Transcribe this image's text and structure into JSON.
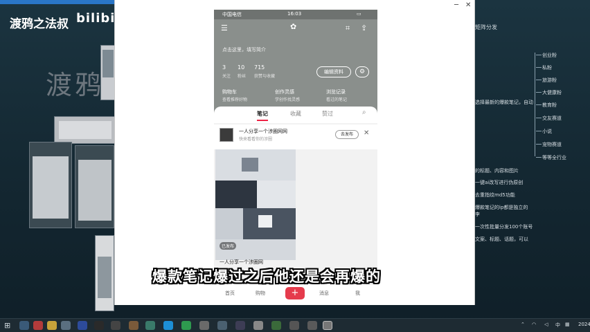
{
  "desktop": {
    "channel_title": "渡鸦之法叔",
    "bili_logo": "bilibili",
    "watermark": "渡鸦之法叔"
  },
  "right_panel": {
    "header": "矩阵分发",
    "mindmap_items": [
      "创业粉",
      "私粉",
      "旅游粉",
      "大健康粉",
      "教育粉",
      "交友赛道",
      "小说",
      "宠物赛道",
      "等等全行业"
    ],
    "notes": [
      "选择最新的爆款笔记，自动",
      "的标题、内容和图片",
      "一键ai改写进行伪原创",
      "去重指纹md5功能",
      "爆款笔记的ip都是独立的",
      "李",
      "一次性批量分发100个账号",
      "文案、标题、话题，可以"
    ]
  },
  "phone": {
    "status": {
      "carrier": "中国电信",
      "time": "16:03"
    },
    "profile": {
      "bio": "点击这里，填写简介",
      "stats": [
        {
          "value": "3",
          "label": "关注"
        },
        {
          "value": "10",
          "label": "粉丝"
        },
        {
          "value": "715",
          "label": "获赞与收藏"
        }
      ],
      "edit_button": "编辑资料",
      "features": [
        {
          "title": "购物车",
          "sub": "查看推荐好物"
        },
        {
          "title": "创作灵感",
          "sub": "学创作找灵感"
        },
        {
          "title": "浏览记录",
          "sub": "看过的笔记"
        }
      ]
    },
    "tabs": [
      "笔记",
      "收藏",
      "赞过"
    ],
    "recommend": {
      "title": "一人分享一个涉圈网网",
      "sub": "快来看看你的涉圈",
      "button": "去发布"
    },
    "note": {
      "tag": "已发布",
      "title": "一人分享一个涉圈网"
    },
    "bottom_nav": [
      "首页",
      "购物",
      "+",
      "消息",
      "我"
    ]
  },
  "subtitle": "爆款笔记爆过之后他还是会再爆的",
  "taskbar": {
    "time": "2024",
    "sys_text": "中"
  }
}
